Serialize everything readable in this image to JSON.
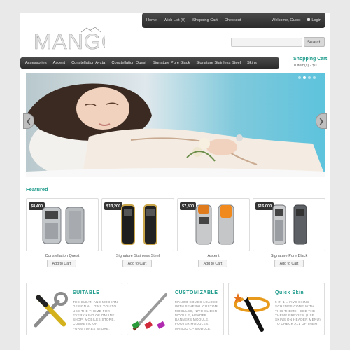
{
  "topbar": {
    "links": [
      "Home",
      "Wish List (0)",
      "Shopping Cart",
      "Checkout"
    ],
    "welcome": "Welcome, Guest",
    "login": "Login"
  },
  "logo": {
    "text": "MANGO"
  },
  "search": {
    "button": "Search",
    "value": ""
  },
  "cart": {
    "title": "Shopping Cart",
    "summary": "0 item(s) - $0"
  },
  "categories": [
    "Accessories",
    "Ascent",
    "Constellation Ayxta",
    "Constellation Quest",
    "Signature Pure Black",
    "Signature Stainless Steel",
    "Skins"
  ],
  "featured": {
    "title": "Featured",
    "add_label": "Add to Cart",
    "products": [
      {
        "name": "Constellation Quest",
        "price": "$8,400"
      },
      {
        "name": "Signature Stainless Steel",
        "price": "$13,200"
      },
      {
        "name": "Ascent",
        "price": "$7,800"
      },
      {
        "name": "Signature Pure Black",
        "price": "$16,000"
      }
    ]
  },
  "features": [
    {
      "title": "SUITABLE",
      "text": "The clean and modern design allows you to use the theme for every kind of online shop: mobiles store, cosmetic or furnitures store.",
      "icon": "tools-icon"
    },
    {
      "title": "CUSTOMIZABLE",
      "text": "Mango comes loaded with several custom modules, Nivo Slider module, header banners module, Footer Modules, Mango CP module.",
      "icon": "paintbrush-icon"
    },
    {
      "title": "Quick Skin",
      "text": "5 in 1 = five skins schemes come with this theme - see the theme preview (use SKINS on header menu) to check all of them.",
      "icon": "magic-wand-icon"
    }
  ],
  "colors": {
    "accent": "#1c9a8a",
    "nav": "#333333"
  }
}
